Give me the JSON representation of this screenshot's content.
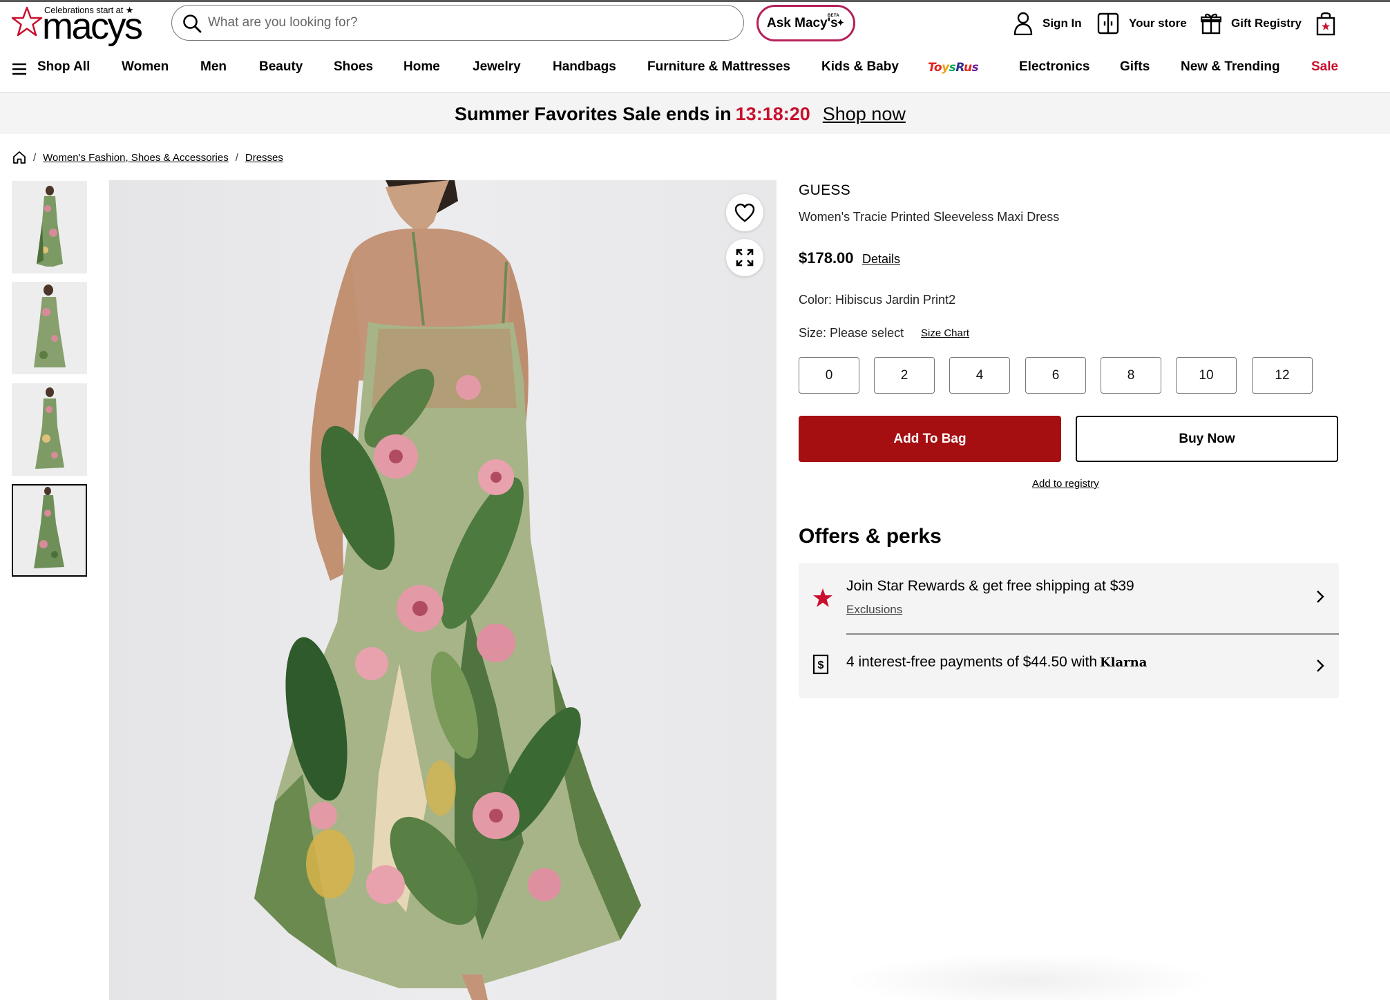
{
  "header": {
    "logo_tagline": "Celebrations start at ★",
    "logo_wordmark": "macys",
    "search_placeholder": "What are you looking for?",
    "ask_macys_label": "Ask Macy's",
    "ask_macys_badge": "BETA",
    "sign_in_label": "Sign In",
    "store_label": "Your store",
    "registry_label": "Gift Registry"
  },
  "nav": {
    "shop_all": "Shop All",
    "items": [
      "Women",
      "Men",
      "Beauty",
      "Shoes",
      "Home",
      "Jewelry",
      "Handbags",
      "Furniture & Mattresses",
      "Kids & Baby",
      "ToysRus",
      "Electronics",
      "Gifts",
      "New & Trending",
      "Sale"
    ]
  },
  "promo": {
    "text": "Summer Favorites Sale ends in",
    "timer": "13:18:20",
    "link": "Shop now"
  },
  "breadcrumb": {
    "items": [
      "Women's Fashion, Shoes & Accessories",
      "Dresses"
    ]
  },
  "product": {
    "brand": "GUESS",
    "name": "Women's Tracie Printed Sleeveless Maxi Dress",
    "price": "$178.00",
    "details_link": "Details",
    "color_label": "Color: Hibiscus Jardin Print2",
    "size_label": "Size: Please select",
    "size_chart_link": "Size Chart",
    "sizes": [
      "0",
      "2",
      "4",
      "6",
      "8",
      "10",
      "12"
    ],
    "add_to_bag": "Add To Bag",
    "buy_now": "Buy Now",
    "add_to_registry": "Add to registry",
    "thumbnail_count": 4,
    "active_thumbnail": 4
  },
  "offers": {
    "title": "Offers & perks",
    "rewards_text": "Join Star Rewards & get free shipping at $39",
    "rewards_link": "Exclusions",
    "klarna_text": "4 interest-free payments of $44.50 with",
    "klarna_brand": "Klarna"
  },
  "colors": {
    "brand_red": "#c8102e",
    "button_red": "#a50f12",
    "ask_macys_border": "#b5205a"
  },
  "icons": [
    "search-icon",
    "user-icon",
    "store-icon",
    "gift-icon",
    "bag-icon",
    "menu-icon",
    "home-icon",
    "heart-icon",
    "expand-icon",
    "star-icon",
    "dollar-icon",
    "chevron-right-icon"
  ]
}
